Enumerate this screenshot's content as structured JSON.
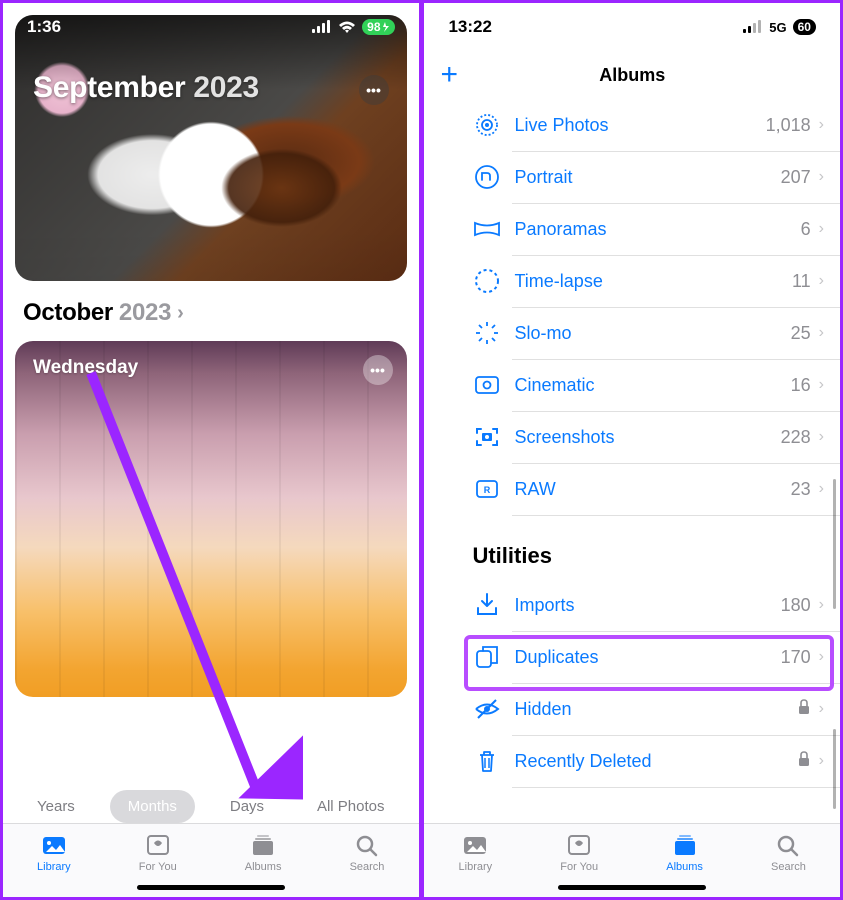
{
  "left": {
    "status": {
      "time": "1:36",
      "battery": "98"
    },
    "card1": {
      "month": "September",
      "year": "2023"
    },
    "header2": {
      "month": "October",
      "year": "2023",
      "chev": "›"
    },
    "card2": {
      "day": "Wednesday"
    },
    "segments": {
      "years": "Years",
      "months": "Months",
      "days": "Days",
      "all": "All Photos"
    },
    "tabs": {
      "library": "Library",
      "foryou": "For You",
      "albums": "Albums",
      "search": "Search"
    }
  },
  "right": {
    "status": {
      "time": "13:22",
      "net": "5G",
      "battery": "60"
    },
    "nav": {
      "title": "Albums",
      "plus": "+"
    },
    "mediaTypes": [
      {
        "icon": "live",
        "label": "Live Photos",
        "count": "1,018"
      },
      {
        "icon": "portrait",
        "label": "Portrait",
        "count": "207"
      },
      {
        "icon": "pano",
        "label": "Panoramas",
        "count": "6"
      },
      {
        "icon": "timelapse",
        "label": "Time-lapse",
        "count": "11"
      },
      {
        "icon": "slomo",
        "label": "Slo-mo",
        "count": "25"
      },
      {
        "icon": "cinematic",
        "label": "Cinematic",
        "count": "16"
      },
      {
        "icon": "screenshots",
        "label": "Screenshots",
        "count": "228"
      },
      {
        "icon": "raw",
        "label": "RAW",
        "count": "23"
      }
    ],
    "utilitiesTitle": "Utilities",
    "utilities": [
      {
        "icon": "imports",
        "label": "Imports",
        "count": "180"
      },
      {
        "icon": "duplicates",
        "label": "Duplicates",
        "count": "170"
      },
      {
        "icon": "hidden",
        "label": "Hidden",
        "lock": true
      },
      {
        "icon": "trash",
        "label": "Recently Deleted",
        "lock": true
      }
    ],
    "tabs": {
      "library": "Library",
      "foryou": "For You",
      "albums": "Albums",
      "search": "Search"
    }
  }
}
